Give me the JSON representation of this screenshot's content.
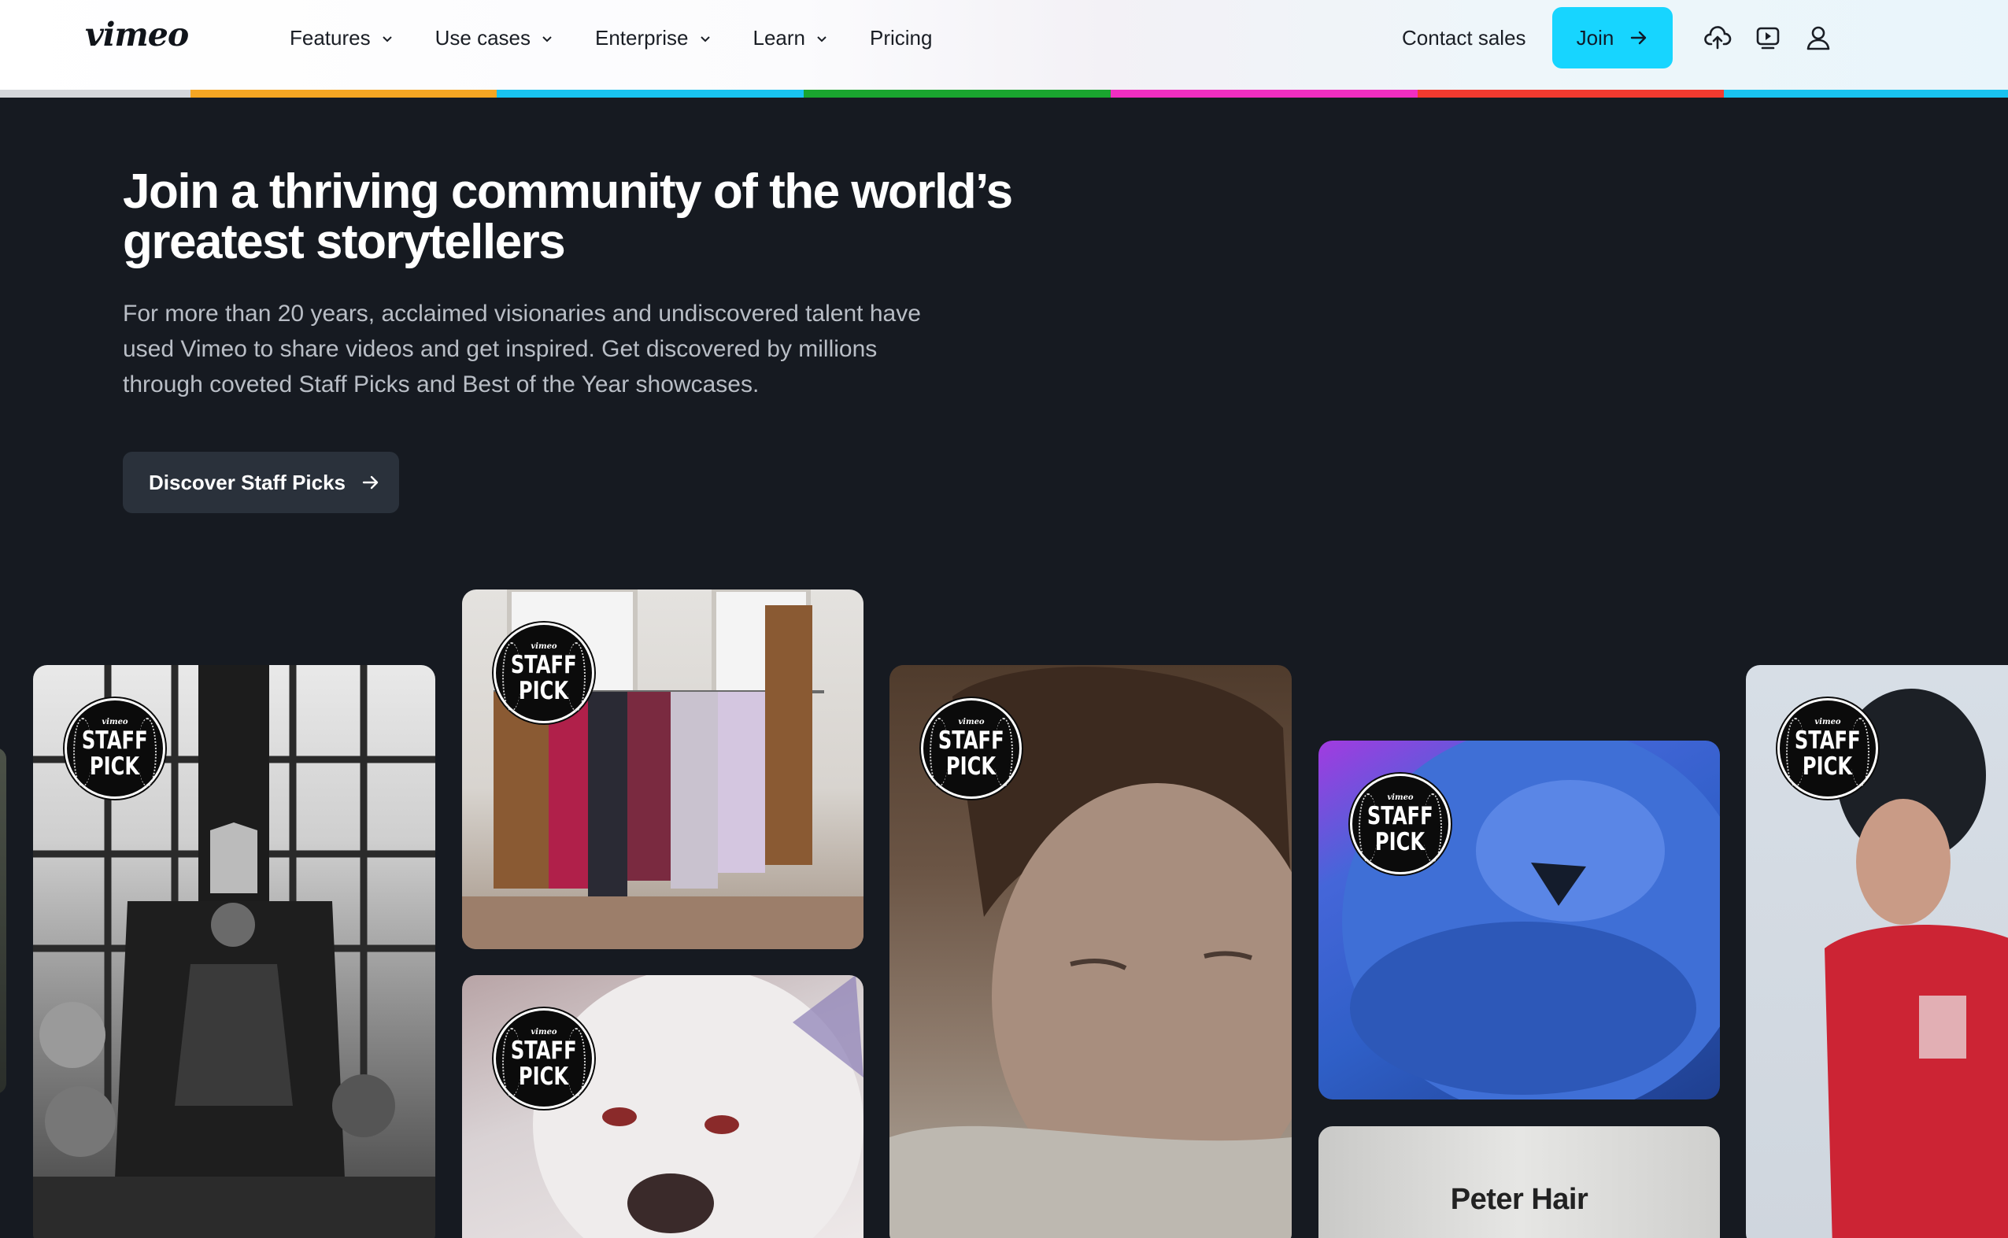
{
  "header": {
    "logo": "vimeo",
    "nav": [
      {
        "label": "Features",
        "has_dropdown": true
      },
      {
        "label": "Use cases",
        "has_dropdown": true
      },
      {
        "label": "Enterprise",
        "has_dropdown": true
      },
      {
        "label": "Learn",
        "has_dropdown": true
      },
      {
        "label": "Pricing",
        "has_dropdown": false
      }
    ],
    "contact_sales": "Contact sales",
    "join_label": "Join",
    "icons": [
      "upload-icon",
      "watch-icon",
      "account-icon"
    ],
    "stripe_colors": [
      "#d5d7db",
      "#f5a623",
      "#19c3f0",
      "#1aa52f",
      "#f02ec1",
      "#f23a2f",
      "#19c3f0"
    ]
  },
  "hero": {
    "title": "Join a thriving community of the world’s greatest storytellers",
    "description": "For more than 20 years, acclaimed visionaries and undiscovered talent have used Vimeo to share videos and get inspired. Get discovered by millions through coveted Staff Picks and Best of the Year showcases.",
    "cta_label": "Discover Staff Picks"
  },
  "badge": {
    "brand": "vimeo",
    "line1": "STAFF",
    "line2": "PICK"
  },
  "cards": [
    {
      "name": "video-card-mask-throne",
      "subject": "black and white throne scene"
    },
    {
      "name": "video-card-clothing-rack",
      "subject": "clothing rack"
    },
    {
      "name": "video-card-white-dog",
      "subject": "white dog"
    },
    {
      "name": "video-card-man-closeup",
      "subject": "man close-up"
    },
    {
      "name": "video-card-blue-monster",
      "subject": "blue furry creature"
    },
    {
      "name": "video-card-peter-hair",
      "title": "Peter Hair"
    },
    {
      "name": "video-card-red-jersey",
      "subject": "person in red jersey"
    }
  ],
  "colors": {
    "background": "#161a21",
    "accent": "#17d5ff",
    "cta_bg": "#2a313b"
  }
}
